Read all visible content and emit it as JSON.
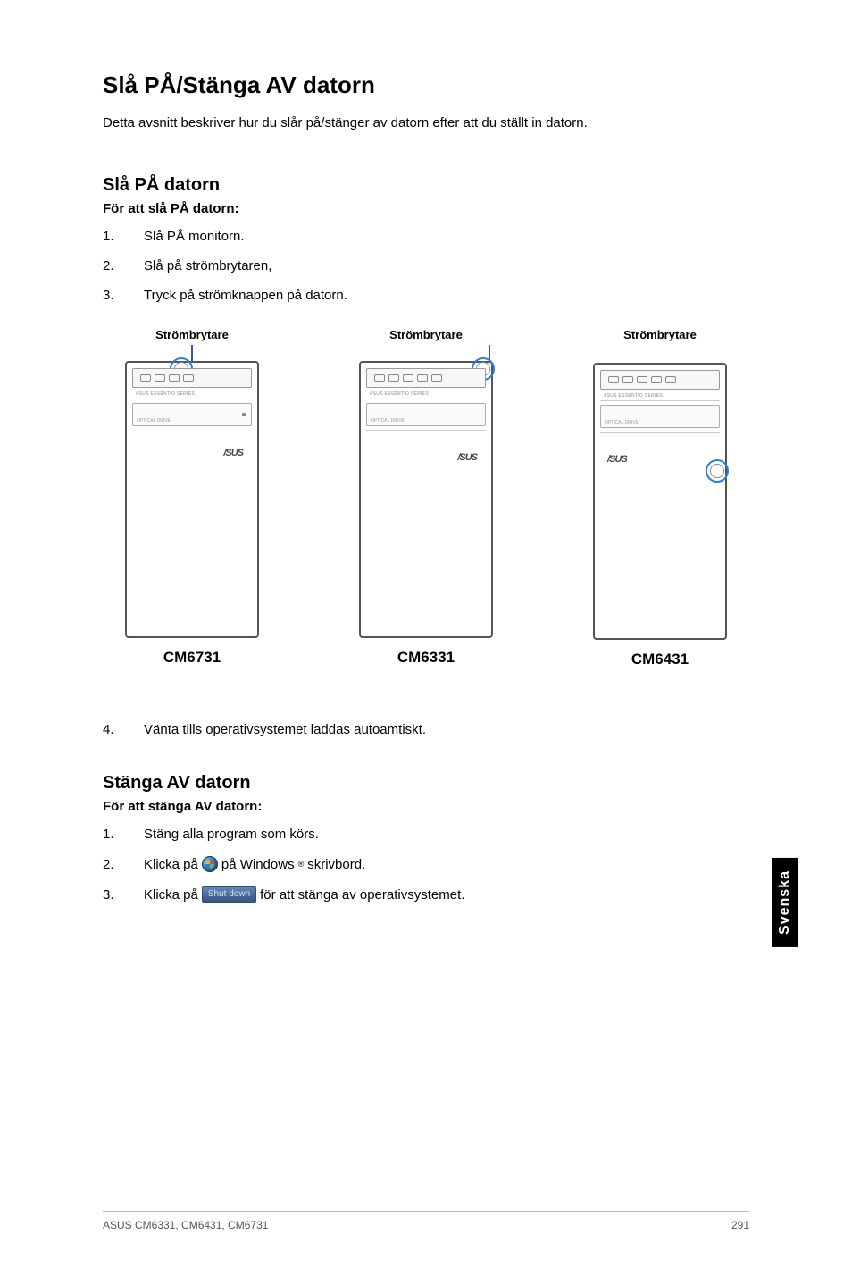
{
  "title": "Slå PÅ/Stänga AV datorn",
  "intro": "Detta avsnitt beskriver hur du slår på/stänger av datorn efter att du ställt in datorn.",
  "section_on": {
    "heading": "Slå PÅ datorn",
    "subheading": "För att slå PÅ datorn:",
    "steps": [
      {
        "n": "1.",
        "t": "Slå PÅ monitorn."
      },
      {
        "n": "2.",
        "t": "Slå på strömbrytaren,"
      },
      {
        "n": "3.",
        "t": "Tryck på strömknappen på datorn."
      }
    ],
    "step4": {
      "n": "4.",
      "t": "Vänta tills operativsystemet laddas autoamtiskt."
    }
  },
  "diagram": {
    "label": "Strömbrytare",
    "brand_label_small": "ASUS ESSENTIO SERIES",
    "drive_label": "OPTICAL DRIVE",
    "logo": "/SUS",
    "models": [
      {
        "name": "CM6731"
      },
      {
        "name": "CM6331"
      },
      {
        "name": "CM6431"
      }
    ]
  },
  "section_off": {
    "heading": "Stänga AV datorn",
    "subheading": "För att stänga AV datorn:",
    "steps": [
      {
        "n": "1.",
        "t": "Stäng alla program som körs."
      },
      {
        "n": "2.",
        "t_before": "Klicka på",
        "t_after_1": "på Windows",
        "t_after_2": " skrivbord."
      },
      {
        "n": "3.",
        "t_before": "Klicka på",
        "btn": "Shut down",
        "t_after": "för att stänga av operativsystemet."
      }
    ]
  },
  "side_tab": "Svenska",
  "footer": {
    "left": "ASUS CM6331, CM6431, CM6731",
    "right": "291"
  },
  "reg_symbol": "®"
}
